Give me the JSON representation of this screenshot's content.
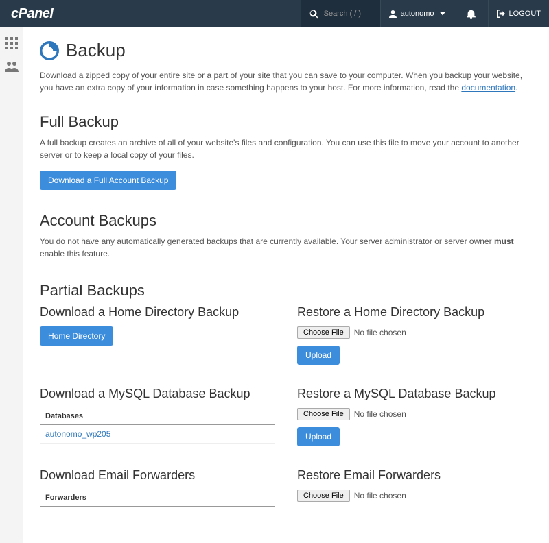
{
  "header": {
    "logo": "cPanel",
    "search_placeholder": "Search ( / )",
    "user_label": "autonomo",
    "logout_label": "LOGOUT"
  },
  "page": {
    "title": "Backup",
    "intro_text": "Download a zipped copy of your entire site or a part of your site that you can save to your computer. When you backup your website, you have an extra copy of your information in case something happens to your host. For more information, read the ",
    "doc_link_text": "documentation"
  },
  "full_backup": {
    "heading": "Full Backup",
    "description": "A full backup creates an archive of all of your website's files and configuration. You can use this file to move your account to another server or to keep a local copy of your files.",
    "button": "Download a Full Account Backup"
  },
  "account_backups": {
    "heading": "Account Backups",
    "description_pre": "You do not have any automatically generated backups that are currently available. Your server administrator or server owner ",
    "description_bold": "must",
    "description_post": " enable this feature."
  },
  "partial": {
    "heading": "Partial Backups",
    "home_dl_heading": "Download a Home Directory Backup",
    "home_dl_button": "Home Directory",
    "home_restore_heading": "Restore a Home Directory Backup",
    "choose_file": "Choose File",
    "no_file": "No file chosen",
    "upload": "Upload",
    "mysql_dl_heading": "Download a MySQL Database Backup",
    "db_table_header": "Databases",
    "db_name": "autonomo_wp205",
    "mysql_restore_heading": "Restore a MySQL Database Backup",
    "email_dl_heading": "Download Email Forwarders",
    "fwd_table_header": "Forwarders",
    "email_restore_heading": "Restore Email Forwarders"
  }
}
